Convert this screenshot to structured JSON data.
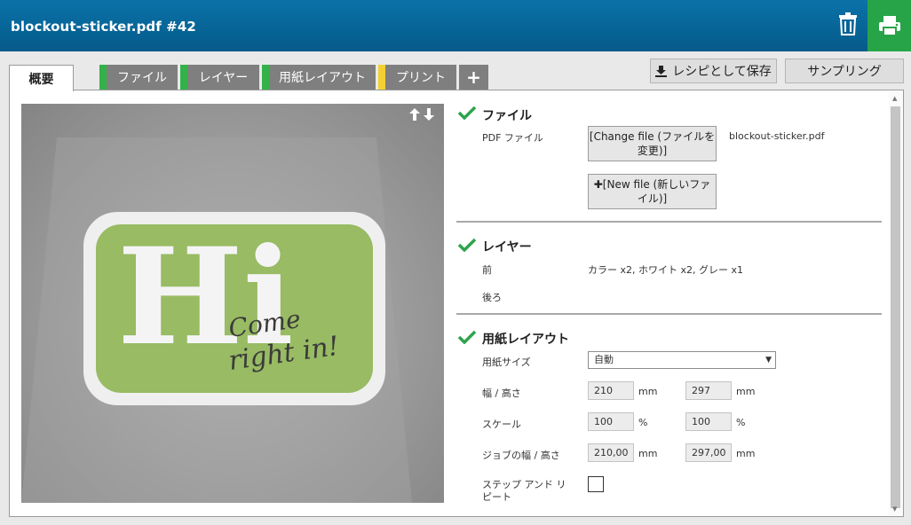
{
  "header": {
    "title": "blockout-sticker.pdf #42"
  },
  "icons": {
    "trash": "trash-icon",
    "print": "printer-icon",
    "plus": "plus-icon",
    "download": "download-icon",
    "check": "checkmark-icon",
    "arrows": "up-down-arrows-icon"
  },
  "colors": {
    "header": "#0664a0",
    "print_button": "#27a447",
    "status_green": "#33b24a",
    "status_yellow": "#f5d033",
    "check": "#2fa34c"
  },
  "tabs": [
    {
      "label": "概要",
      "status": "active"
    },
    {
      "label": "ファイル",
      "status": "green"
    },
    {
      "label": "レイヤー",
      "status": "green"
    },
    {
      "label": "用紙レイアウト",
      "status": "green"
    },
    {
      "label": "プリント",
      "status": "yellow"
    },
    {
      "label": "+"
    }
  ],
  "toolbar": {
    "save_recipe": "レシピとして保存",
    "sampling": "サンプリング"
  },
  "preview": {
    "sticker_big_text": "Hi",
    "sticker_script_line1": "Come",
    "sticker_script_line2": "right in!"
  },
  "file_section": {
    "title": "ファイル",
    "pdf_label": "PDF ファイル",
    "change_file": "[Change file (ファイルを変更)]",
    "new_file": "[New file (新しいファイル)]",
    "file_name": "blockout-sticker.pdf"
  },
  "layer_section": {
    "title": "レイヤー",
    "front_label": "前",
    "front_value": "カラー x2, ホワイト x2, グレー x1",
    "back_label": "後ろ"
  },
  "layout_section": {
    "title": "用紙レイアウト",
    "paper_size_label": "用紙サイズ",
    "paper_size_value": "自動",
    "width_height_label": "幅 / 高さ",
    "width": "210",
    "height": "297",
    "scale_label": "スケール",
    "scale_x": "100",
    "scale_y": "100",
    "job_size_label": "ジョブの幅 / 高さ",
    "job_width": "210,00",
    "job_height": "297,00",
    "step_repeat_label": "ステップ アンド リピート",
    "unit_mm": "mm",
    "unit_percent": "%"
  }
}
